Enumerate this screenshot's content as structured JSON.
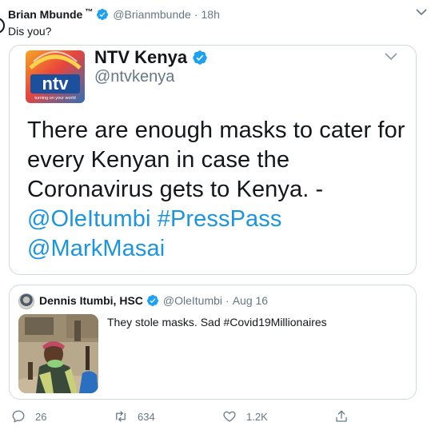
{
  "tweet": {
    "author_name": "Brian Mbunde",
    "trademark": "™",
    "handle": "@Brianmbunde",
    "separator": "·",
    "time": "18h",
    "text": "Dis you?"
  },
  "media": {
    "logo_text": "ntv",
    "logo_tagline": "turning on your world",
    "name": "NTV Kenya",
    "handle": "@ntvkenya",
    "text_line1": "There are enough masks to cater for",
    "text_line2": "every Kenyan in case the",
    "text_line3": "Coronavirus gets to Kenya. -",
    "mention1": "@OleItumbi",
    "hashtag": "#PressPass",
    "mention2": "@MarkMasai"
  },
  "quote": {
    "author_name": "Dennis Itumbi, HSC",
    "handle": "@OleItumbi",
    "separator": "·",
    "date": "Aug 16",
    "text": "They stole masks. Sad #Covid19Millionaires"
  },
  "actions": {
    "replies": "26",
    "retweets": "634",
    "likes": "1.2K"
  },
  "colors": {
    "link": "#1b95e0",
    "verified": "#1da1f2",
    "muted": "#657786",
    "border": "#cfd9de"
  }
}
